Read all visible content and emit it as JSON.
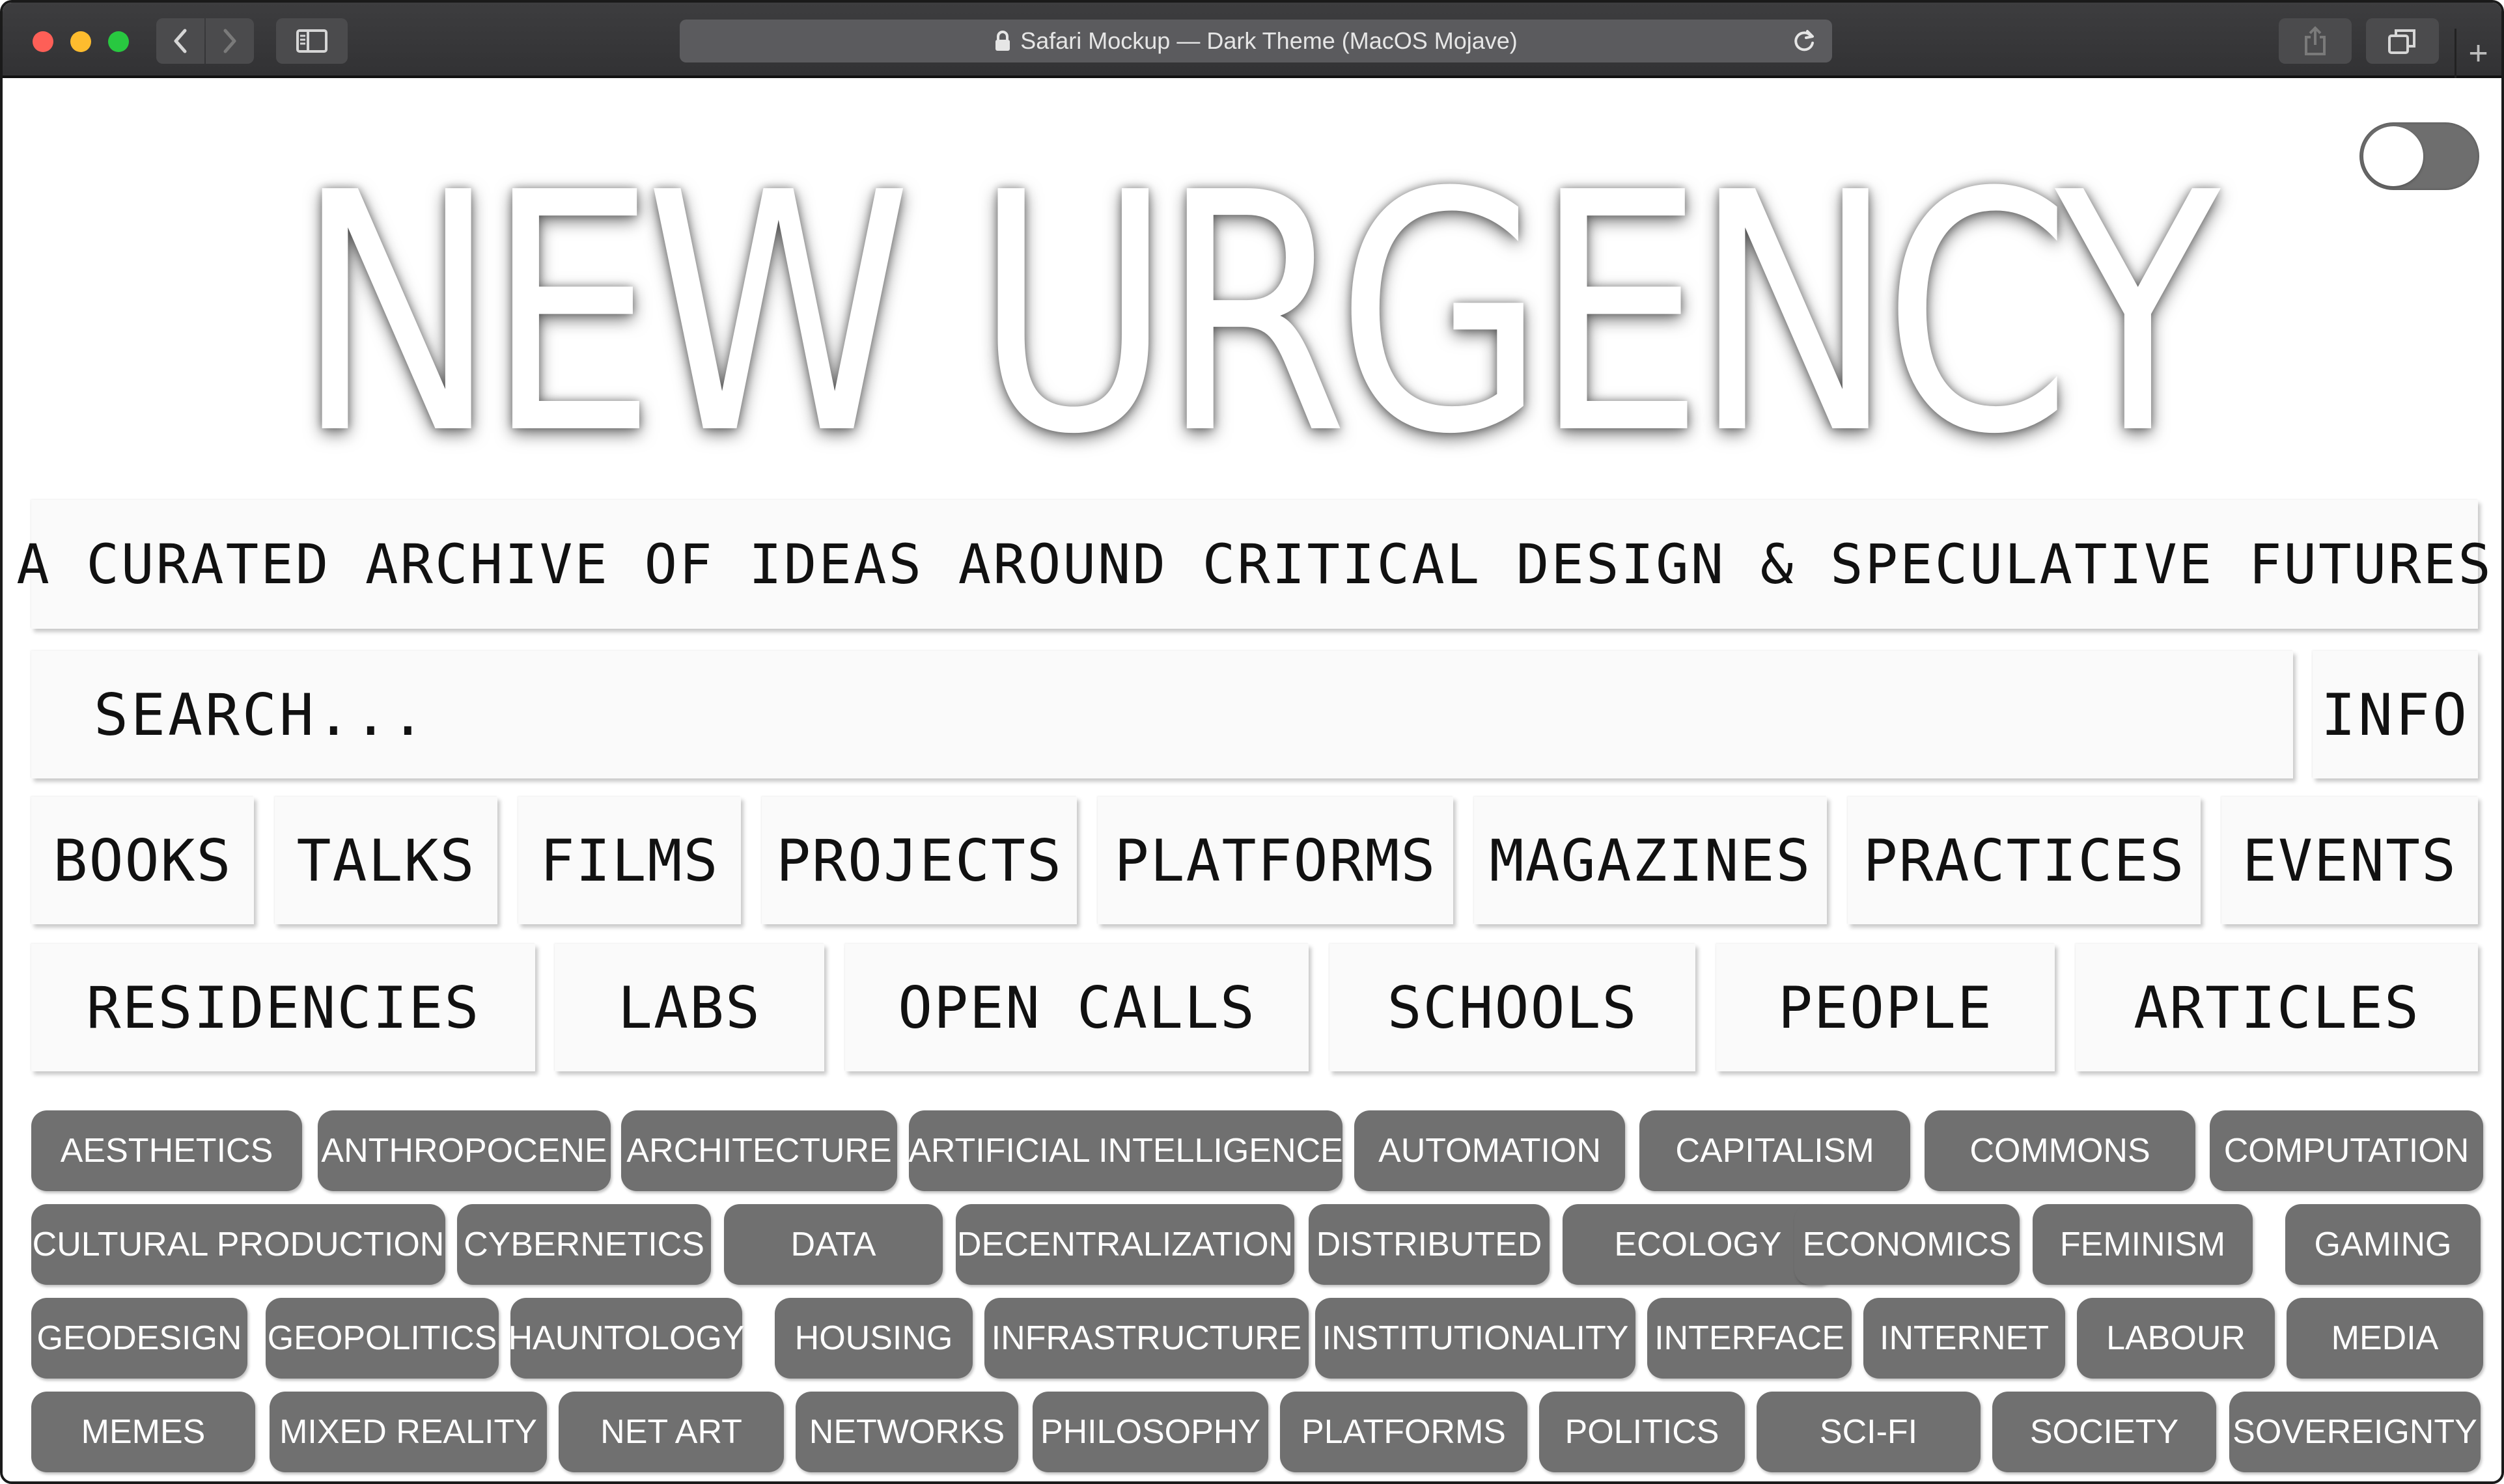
{
  "browser": {
    "url_title": "Safari Mockup — Dark Theme (MacOS Mojave)",
    "new_tab_label": "+"
  },
  "hero": {
    "title": "NEW URGENCY"
  },
  "tagline": "A CURATED ARCHIVE OF IDEAS AROUND CRITICAL DESIGN & SPECULATIVE FUTURES",
  "search": {
    "placeholder": "SEARCH..."
  },
  "info_label": "INFO",
  "nav_row1": [
    "BOOKS",
    "TALKS",
    "FILMS",
    "PROJECTS",
    "PLATFORMS",
    "MAGAZINES",
    "PRACTICES",
    "EVENTS"
  ],
  "nav_row2": [
    "RESIDENCIES",
    "LABS",
    "OPEN CALLS",
    "SCHOOLS",
    "PEOPLE",
    "ARTICLES"
  ],
  "tags": [
    [
      "AESTHETICS",
      "ANTHROPOCENE",
      "ARCHITECTURE",
      "ARTIFICIAL INTELLIGENCE",
      "AUTOMATION",
      "CAPITALISM",
      "COMMONS",
      "COMPUTATION"
    ],
    [
      "CULTURAL PRODUCTION",
      "CYBERNETICS",
      "DATA",
      "DECENTRALIZATION",
      "DISTRIBUTED",
      "ECOLOGY",
      "ECONOMICS",
      "FEMINISM",
      "GAMING"
    ],
    [
      "GEODESIGN",
      "GEOPOLITICS",
      "HAUNTOLOGY",
      "HOUSING",
      "INFRASTRUCTURE",
      "INSTITUTIONALITY",
      "INTERFACE",
      "INTERNET",
      "LABOUR",
      "MEDIA"
    ],
    [
      "MEMES",
      "MIXED REALITY",
      "NET ART",
      "NETWORKS",
      "PHILOSOPHY",
      "PLATFORMS",
      "POLITICS",
      "SCI-FI",
      "SOCIETY",
      "SOVEREIGNTY"
    ]
  ],
  "colors": {
    "chip_bg": "#707070",
    "titlebar_bg": "#3d3d3f",
    "page_bg": "#ffffff"
  }
}
